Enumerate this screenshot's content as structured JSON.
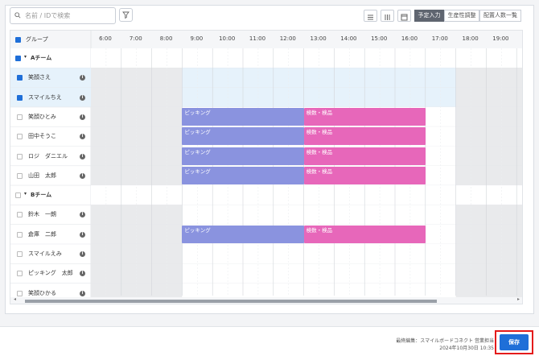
{
  "search": {
    "placeholder": "名前 / IDで検索"
  },
  "view_tabs": [
    "予定入力",
    "生産性調整",
    "配置人数一覧"
  ],
  "active_tab": "予定入力",
  "grid": {
    "group_header": "グループ",
    "hours": [
      "6:00",
      "7:00",
      "8:00",
      "9:00",
      "10:00",
      "11:00",
      "12:00",
      "13:00",
      "14:00",
      "15:00",
      "16:00",
      "17:00",
      "18:00",
      "19:00"
    ],
    "rows": [
      {
        "type": "team",
        "label": "Aチーム",
        "checked": "partial"
      },
      {
        "type": "member",
        "label": "笑顔さえ",
        "checked": true,
        "highlight": true
      },
      {
        "type": "member",
        "label": "スマイルちえ",
        "checked": true,
        "highlight": true
      },
      {
        "type": "member",
        "label": "笑顔ひとみ",
        "checked": false,
        "tasks": [
          {
            "label": "ピッキング",
            "start": 9,
            "end": 13,
            "kind": "pick"
          },
          {
            "label": "検数・検品",
            "start": 13,
            "end": 17,
            "kind": "insp"
          }
        ]
      },
      {
        "type": "member",
        "label": "田中そうこ",
        "checked": false,
        "tasks": [
          {
            "label": "ピッキング",
            "start": 9,
            "end": 13,
            "kind": "pick"
          },
          {
            "label": "検数・検品",
            "start": 13,
            "end": 17,
            "kind": "insp"
          }
        ]
      },
      {
        "type": "member",
        "label": "ロジ　ダニエル",
        "checked": false,
        "tasks": [
          {
            "label": "ピッキング",
            "start": 9,
            "end": 13,
            "kind": "pick"
          },
          {
            "label": "検数・検品",
            "start": 13,
            "end": 17,
            "kind": "insp"
          }
        ]
      },
      {
        "type": "member",
        "label": "山田　太郎",
        "checked": false,
        "tasks": [
          {
            "label": "ピッキング",
            "start": 9,
            "end": 13,
            "kind": "pick"
          },
          {
            "label": "検数・検品",
            "start": 13,
            "end": 17,
            "kind": "insp"
          }
        ]
      },
      {
        "type": "team",
        "label": "Bチーム",
        "checked": false
      },
      {
        "type": "member",
        "label": "鈴木　一朗",
        "checked": false
      },
      {
        "type": "member",
        "label": "倉庫　二郎",
        "checked": false,
        "tasks": [
          {
            "label": "ピッキング",
            "start": 9,
            "end": 13,
            "kind": "pick"
          },
          {
            "label": "検数・検品",
            "start": 13,
            "end": 17,
            "kind": "insp"
          }
        ]
      },
      {
        "type": "member",
        "label": "スマイルえみ",
        "checked": false
      },
      {
        "type": "member",
        "label": "ピッキング　太郎",
        "checked": false
      },
      {
        "type": "member",
        "label": "笑顔ひかる",
        "checked": false
      }
    ]
  },
  "footer": {
    "last_edit": "最終編集：スマイルボードコネクト 営業担当",
    "last_edit_date": "2024年10月30日 10:35",
    "save_label": "保存"
  },
  "colors": {
    "pick": "#8a93df",
    "insp": "#e767ba",
    "accent": "#1f6fd8",
    "highlight": "#e6f2fb",
    "offhours": "#e9eaec"
  }
}
